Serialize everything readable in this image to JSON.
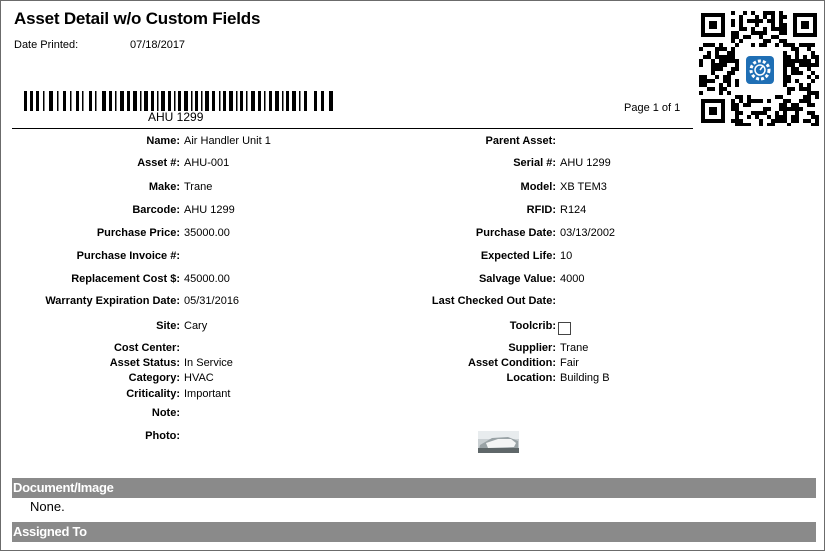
{
  "report": {
    "title": "Asset Detail w/o Custom Fields",
    "date_printed_label": "Date Printed:",
    "date_printed_value": "07/18/2017",
    "barcode_text": "AHU 1299",
    "page_info": "Page 1 of 1"
  },
  "fields": {
    "name": {
      "label": "Name:",
      "value": "Air Handler Unit 1"
    },
    "parent_asset": {
      "label": "Parent Asset:",
      "value": ""
    },
    "asset_number": {
      "label": "Asset #:",
      "value": "AHU-001"
    },
    "serial_number": {
      "label": "Serial #:",
      "value": "AHU 1299"
    },
    "make": {
      "label": "Make:",
      "value": "Trane"
    },
    "model": {
      "label": "Model:",
      "value": "XB TEM3"
    },
    "barcode": {
      "label": "Barcode:",
      "value": "AHU 1299"
    },
    "rfid": {
      "label": "RFID:",
      "value": "R124"
    },
    "purchase_price": {
      "label": "Purchase Price:",
      "value": "35000.00"
    },
    "purchase_date": {
      "label": "Purchase Date:",
      "value": "03/13/2002"
    },
    "purchase_invoice": {
      "label": "Purchase Invoice #:",
      "value": ""
    },
    "expected_life": {
      "label": "Expected Life:",
      "value": "10"
    },
    "replacement_cost": {
      "label": "Replacement Cost $:",
      "value": "45000.00"
    },
    "salvage_value": {
      "label": "Salvage Value:",
      "value": "4000"
    },
    "warranty_expiration": {
      "label": "Warranty Expiration Date:",
      "value": "05/31/2016"
    },
    "last_checked_out": {
      "label": "Last Checked Out Date:",
      "value": ""
    },
    "site": {
      "label": "Site:",
      "value": "Cary"
    },
    "toolcrib": {
      "label": "Toolcrib:",
      "checked": false
    },
    "cost_center": {
      "label": "Cost Center:",
      "value": ""
    },
    "supplier": {
      "label": "Supplier:",
      "value": "Trane"
    },
    "asset_status": {
      "label": "Asset Status:",
      "value": "In Service"
    },
    "asset_condition": {
      "label": "Asset Condition:",
      "value": "Fair"
    },
    "category": {
      "label": "Category:",
      "value": "HVAC"
    },
    "location": {
      "label": "Location:",
      "value": "Building B"
    },
    "criticality": {
      "label": "Criticality:",
      "value": "Important"
    },
    "note": {
      "label": "Note:",
      "value": ""
    },
    "photo": {
      "label": "Photo:"
    }
  },
  "sections": {
    "document_image": {
      "title": "Document/Image",
      "content": "None."
    },
    "assigned_to": {
      "title": "Assigned To"
    }
  },
  "icons": {
    "qr_logo": "gear-gauge-icon",
    "logo_color": "#1f6fb5"
  }
}
